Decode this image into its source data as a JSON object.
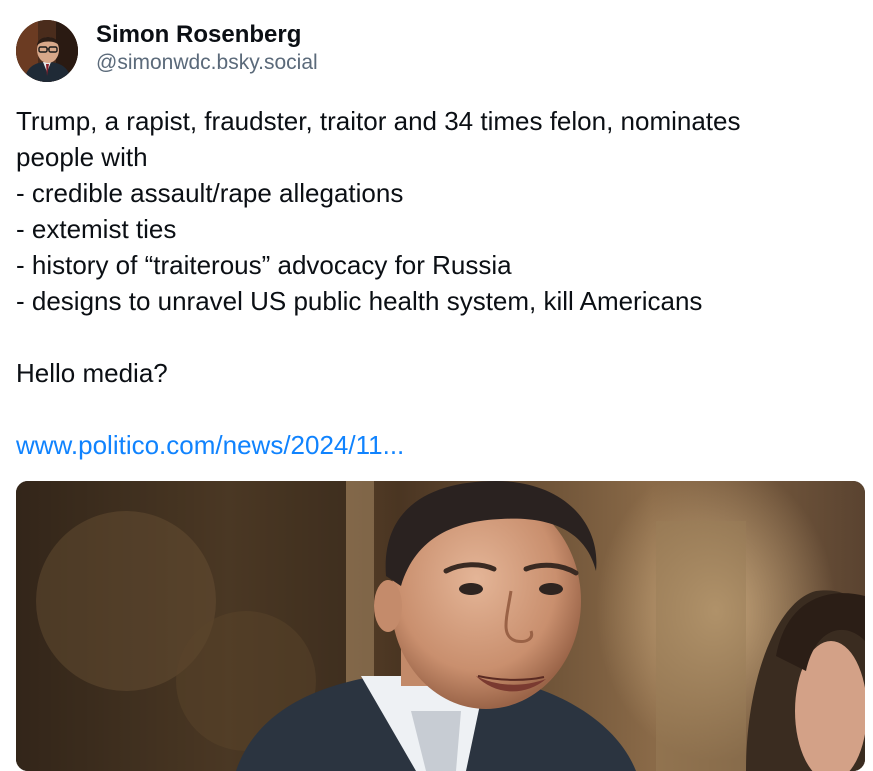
{
  "author": {
    "display_name": "Simon Rosenberg",
    "handle": "@simonwdc.bsky.social",
    "avatar_icon": "person-avatar-icon"
  },
  "post": {
    "lines": [
      "Trump, a rapist, fraudster, traitor and 34 times felon, nominates",
      "people with",
      "- credible assault/rape allegations",
      "- extemist ties",
      "- history of “traiterous” advocacy for Russia",
      "- designs to unravel US public health system, kill Americans"
    ],
    "closing": "Hello media?",
    "link_text": "www.politico.com/news/2024/11..."
  },
  "colors": {
    "link": "#1083fe",
    "handle": "#5b6a7a",
    "text": "#0b0f14"
  },
  "embed": {
    "image_icon": "photo-man-in-suit-icon"
  }
}
